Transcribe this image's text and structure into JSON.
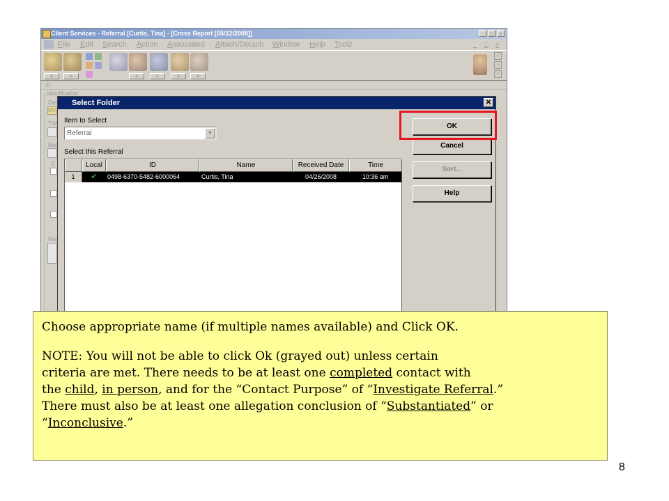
{
  "app": {
    "title": "Client Services - Referral [Curtis, Tina] - [Cross Report [05/12/2008]]",
    "menu": [
      "File",
      "Edit",
      "Search",
      "Action",
      "Associated",
      "Attach/Detach",
      "Window",
      "Help",
      "Toolz"
    ],
    "id_label": "ID",
    "identification_label": "Identification",
    "side_labels": [
      "Dat",
      "05/",
      "Title",
      "Bac",
      "S",
      "Nar"
    ]
  },
  "dialog": {
    "title": "Select Folder",
    "item_label": "Item to Select",
    "combo_value": "Referral",
    "select_label": "Select this Referral",
    "columns": [
      "Local",
      "ID",
      "Name",
      "Received Date",
      "Time"
    ],
    "rows": [
      {
        "num": "1",
        "local_check": "✔",
        "id": "0498-6370-5482-6000064",
        "name": "Curtis, Tina",
        "received": "04/26/2008",
        "time": "10:36 am"
      }
    ],
    "buttons": {
      "ok": "OK",
      "cancel": "Cancel",
      "sort": "Sort...",
      "help": "Help"
    },
    "close": "✕"
  },
  "note": {
    "line1": "Choose appropriate name (if multiple names available) and Click OK.",
    "line2": "NOTE: You will not be able to click Ok (grayed out) unless certain",
    "line3_a": "criteria are met. There needs to be at least one ",
    "line3_u": "completed",
    "line3_b": " contact with",
    "line4_a": "the ",
    "line4_u1": "child",
    "line4_b": ", ",
    "line4_u2": "in person",
    "line4_c": ", and for the “Contact Purpose” of “",
    "line4_u3": "Investigate Referral",
    "line4_d": ".”",
    "line5_a": "There must also be at least one allegation conclusion of “",
    "line5_u": "Substantiated",
    "line5_b": "” or",
    "line6_a": "“",
    "line6_u": "Inconclusive",
    "line6_b": ".”"
  },
  "page_number": "8",
  "colors": {
    "highlight": "#e8141e",
    "note_bg": "#ffff99",
    "dialog_title": "#0a246a",
    "selected_row": "#000000"
  }
}
